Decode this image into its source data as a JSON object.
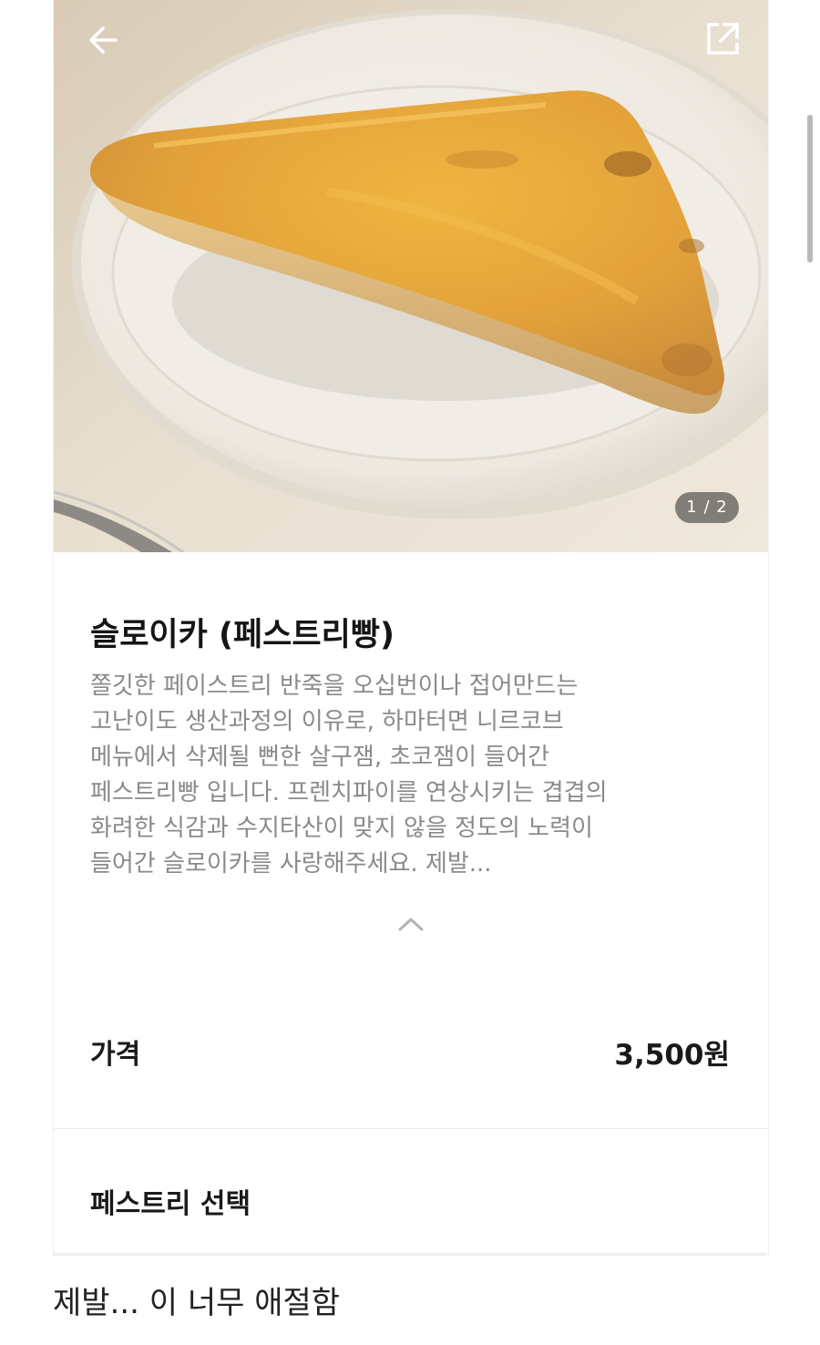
{
  "hero": {
    "image_counter": "1 / 2",
    "back_icon": "arrow-left-icon",
    "share_icon": "share-external-icon"
  },
  "product": {
    "title": "슬로이카 (페스트리빵)",
    "description_lines": [
      "쫄깃한 페이스트리 반죽을 오십번이나 접어만드는",
      "고난이도 생산과정의 이유로, 하마터면 니르코브",
      "메뉴에서 삭제될 뻔한 살구잼, 초코잼이 들어간",
      "페스트리빵 입니다. 프렌치파이를 연상시키는 겹겹의",
      "화려한 식감과 수지타산이 맞지 않을 정도의 노력이",
      "들어간 슬로이카를 사랑해주세요. 제발..."
    ],
    "collapse_icon": "chevron-up-icon"
  },
  "price": {
    "label": "가격",
    "value": "3,500원"
  },
  "options": {
    "section_label": "페스트리 선택"
  },
  "caption": "제발... 이 너무 애절함",
  "colors": {
    "title": "#151515",
    "description": "#8a8a8a",
    "counter_bg": "#282828",
    "pastry": "#e0a23c"
  }
}
